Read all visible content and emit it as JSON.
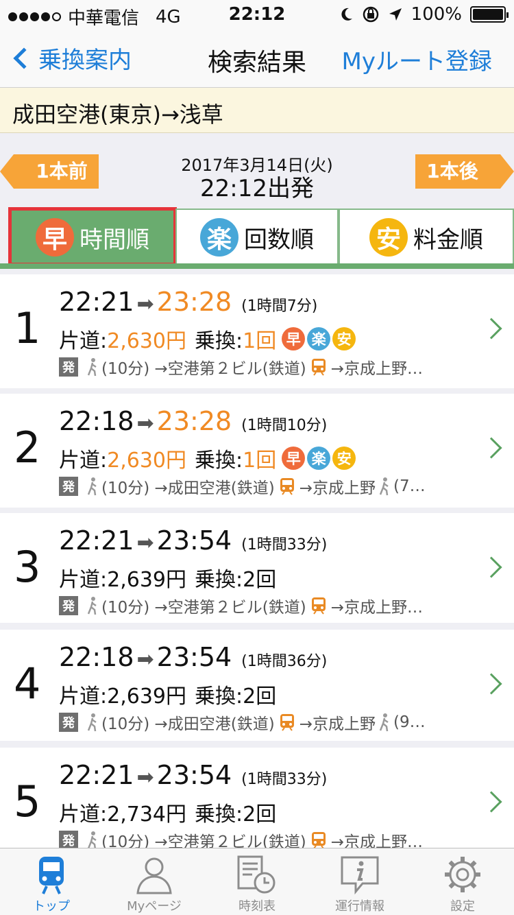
{
  "status_bar": {
    "carrier": "中華電信",
    "network": "4G",
    "time": "22:12",
    "battery": "100%"
  },
  "nav": {
    "back_label": "乗換案内",
    "title": "検索結果",
    "right_label": "Myルート登録"
  },
  "route": "成田空港(東京)→浅草",
  "date_time": {
    "date": "2017年3月14日(火)",
    "departure": "22:12出発",
    "prev_label": "1本前",
    "next_label": "1本後"
  },
  "sort_tabs": [
    {
      "icon_char": "早",
      "label": "時間順",
      "color": "#ef6b3b"
    },
    {
      "icon_char": "楽",
      "label": "回数順",
      "color": "#48a7d8"
    },
    {
      "icon_char": "安",
      "label": "料金順",
      "color": "#f5b60f"
    }
  ],
  "labels": {
    "fare_prefix": "片道:",
    "transfer_prefix": "乗換:",
    "depart_badge": "発",
    "badge_haya": "早",
    "badge_raku": "楽",
    "badge_yasu": "安"
  },
  "results": [
    {
      "index": "1",
      "dep": "22:21",
      "arr": "23:28",
      "duration": "(1時間7分)",
      "fare": "2,630円",
      "transfers": "1回",
      "detail_walk": "(10分)",
      "detail_route": "→空港第２ビル(鉄道)",
      "detail_next": "→京成上野…"
    },
    {
      "index": "2",
      "dep": "22:18",
      "arr": "23:28",
      "duration": "(1時間10分)",
      "fare": "2,630円",
      "transfers": "1回",
      "detail_walk": "(10分)",
      "detail_route": "→成田空港(鉄道)",
      "detail_next": "→京成上野",
      "detail_tail": "(7…"
    },
    {
      "index": "3",
      "dep": "22:21",
      "arr": "23:54",
      "duration": "(1時間33分)",
      "fare": "2,639円",
      "transfers": "2回",
      "detail_walk": "(10分)",
      "detail_route": "→空港第２ビル(鉄道)",
      "detail_next": "→京成上野…"
    },
    {
      "index": "4",
      "dep": "22:18",
      "arr": "23:54",
      "duration": "(1時間36分)",
      "fare": "2,639円",
      "transfers": "2回",
      "detail_walk": "(10分)",
      "detail_route": "→成田空港(鉄道)",
      "detail_next": "→京成上野",
      "detail_tail": "(9…"
    },
    {
      "index": "5",
      "dep": "22:21",
      "arr": "23:54",
      "duration": "(1時間33分)",
      "fare": "2,734円",
      "transfers": "2回",
      "detail_walk": "(10分)",
      "detail_route": "→空港第２ビル(鉄道)",
      "detail_next": "→京成上野…"
    }
  ],
  "tab_bar": [
    {
      "label": "トップ",
      "icon": "train-icon"
    },
    {
      "label": "Myページ",
      "icon": "person-icon"
    },
    {
      "label": "時刻表",
      "icon": "timetable-icon"
    },
    {
      "label": "運行情報",
      "icon": "info-icon"
    },
    {
      "label": "設定",
      "icon": "gear-icon"
    }
  ],
  "colors": {
    "accent_blue": "#1e7ed8",
    "orange": "#f08a24",
    "green": "#6aac6f",
    "highlight_red": "#e5343a"
  }
}
